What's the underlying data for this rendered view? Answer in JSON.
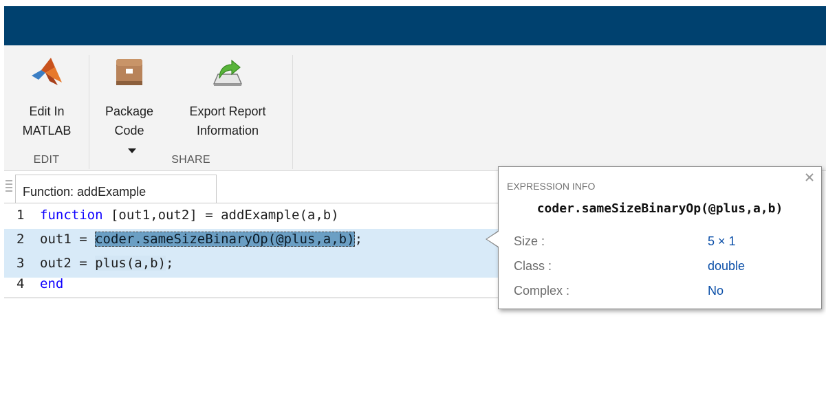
{
  "toolstrip": {
    "groups": [
      {
        "label": "EDIT",
        "tools": [
          {
            "label_line1": "Edit In",
            "label_line2": "MATLAB",
            "icon": "matlab-logo-icon"
          }
        ]
      },
      {
        "label": "SHARE",
        "tools": [
          {
            "label_line1": "Package",
            "label_line2": "Code",
            "icon": "package-box-icon",
            "dropdown": true
          },
          {
            "label_line1": "Export Report",
            "label_line2": "Information",
            "icon": "export-report-icon"
          }
        ]
      }
    ]
  },
  "editor": {
    "tab_label": "Function: addExample",
    "lines": [
      {
        "number": "1",
        "kw": "function",
        "text": " [out1,out2] = addExample(a,b)"
      },
      {
        "number": "2",
        "prefix": "out1 = ",
        "selected": "coder.sameSizeBinaryOp(@plus,a,b)",
        "suffix": ";"
      },
      {
        "number": "3",
        "prefix": "out2 = ",
        "highlight": "plus(a,b)",
        "suffix": ";"
      },
      {
        "number": "4",
        "kw": "end"
      }
    ]
  },
  "tooltip": {
    "title": "EXPRESSION INFO",
    "expression": "coder.sameSizeBinaryOp(@plus,a,b)",
    "rows": [
      {
        "key": "Size :",
        "value": "5 × 1"
      },
      {
        "key": "Class :",
        "value": "double"
      },
      {
        "key": "Complex :",
        "value": "No"
      }
    ]
  },
  "colors": {
    "titlebar": "#00416f",
    "toolstrip": "#f3f3f3",
    "keyword": "#0e00ff",
    "selection": "#6b9fc4",
    "value": "#0b4fa8"
  }
}
